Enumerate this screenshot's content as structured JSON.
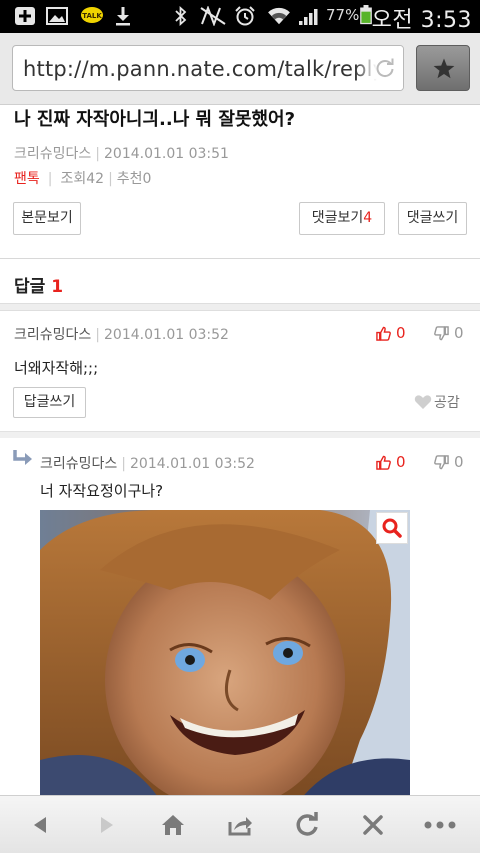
{
  "status_bar": {
    "battery_percent": "77%",
    "time": "오전 3:53",
    "icons": [
      "add-icon",
      "gallery-icon",
      "kakaotalk-icon",
      "download-icon",
      "bluetooth-icon",
      "mute-icon",
      "alarm-icon",
      "wifi-icon",
      "signal-icon",
      "battery-icon"
    ],
    "kakao_label": "TALK"
  },
  "browser": {
    "url": "http://m.pann.nate.com/talk/reply/s",
    "bookmark_icon": "star-icon"
  },
  "post": {
    "title": "나 진짜 자작아니긔..나 뭐 잘못했어?",
    "author": "크리슈밍다스",
    "date": "2014.01.01 03:51",
    "category": "팬톡",
    "views_label": "조회42",
    "recommend_label": "추천0"
  },
  "actions": {
    "view_post": "본문보기",
    "view_comments_label": "댓글보기",
    "comment_count": "4",
    "write_comment": "댓글쓰기"
  },
  "replies": {
    "header_label": "답글",
    "count": "1",
    "items": [
      {
        "author": "크리슈밍다스",
        "date": "2014.01.01 03:52",
        "up": "0",
        "down": "0",
        "text": "너왜자작해;;;",
        "reply_button": "답글쓰기",
        "like_label": "공감"
      },
      {
        "author": "크리슈밍다스",
        "date": "2014.01.01 03:52",
        "up": "0",
        "down": "0",
        "text": "너 자작요정이구나?"
      }
    ]
  },
  "colors": {
    "accent_red": "#e8231e",
    "thumb_down_gray": "#999999"
  },
  "toolbar": {
    "icons": [
      "back-icon",
      "forward-icon",
      "home-icon",
      "share-icon",
      "refresh-icon",
      "close-icon",
      "more-icon"
    ]
  }
}
